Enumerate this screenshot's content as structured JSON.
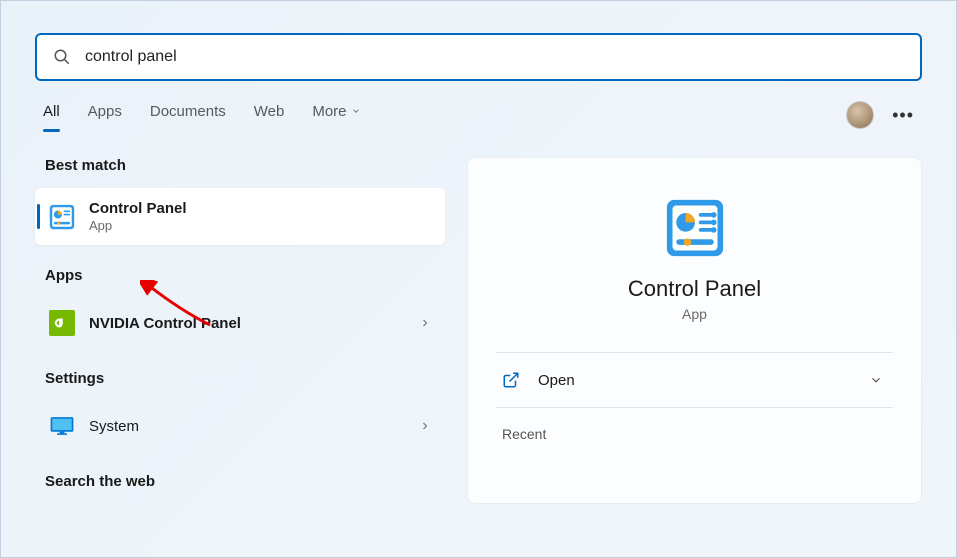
{
  "search": {
    "query": "control panel"
  },
  "tabs": {
    "all": "All",
    "apps": "Apps",
    "documents": "Documents",
    "web": "Web",
    "more": "More"
  },
  "sections": {
    "best_match": "Best match",
    "apps": "Apps",
    "settings": "Settings",
    "search_web": "Search the web"
  },
  "results": {
    "best_match": {
      "title": "Control Panel",
      "subtitle": "App"
    },
    "nvidia": {
      "prefix": "NVIDIA ",
      "bold": "Control Panel"
    },
    "system": {
      "title": "System"
    }
  },
  "detail": {
    "title": "Control Panel",
    "subtitle": "App",
    "open": "Open",
    "recent": "Recent"
  }
}
